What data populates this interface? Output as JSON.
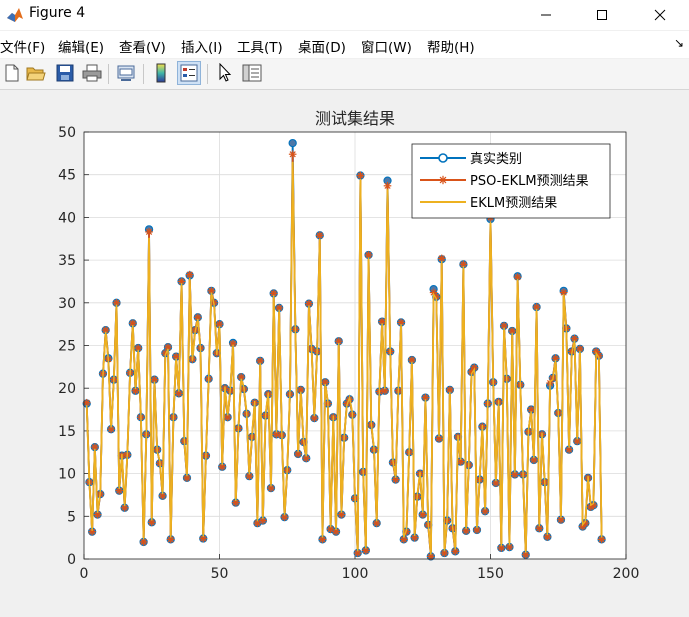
{
  "window": {
    "title": "Figure 4"
  },
  "menu": [
    "文件(F)",
    "编辑(E)",
    "查看(V)",
    "插入(I)",
    "工具(T)",
    "桌面(D)",
    "窗口(W)",
    "帮助(H)"
  ],
  "toolbar": {
    "icons": [
      "new-figure-icon",
      "open-file-icon",
      "save-icon",
      "print-icon",
      "link-plot-icon",
      "insert-colorbar-icon",
      "insert-legend-icon",
      "edit-plot-arrow-icon",
      "property-inspector-icon"
    ]
  },
  "colors": {
    "series1": "#0072bd",
    "series2": "#d95319",
    "series3": "#edb120",
    "marker_face": "#4d78a8"
  },
  "chart_data": {
    "type": "line",
    "title": "测试集结果",
    "xlim": [
      0,
      200
    ],
    "ylim": [
      0,
      50
    ],
    "xticks": [
      0,
      50,
      100,
      150,
      200
    ],
    "yticks": [
      0,
      5,
      10,
      15,
      20,
      25,
      30,
      35,
      40,
      45,
      50
    ],
    "grid": true,
    "legend_position": "top-right",
    "series": [
      {
        "name": "真实类别",
        "marker": "o"
      },
      {
        "name": "PSO-EKLM预测结果",
        "marker": "*"
      },
      {
        "name": "EKLM预测结果",
        "marker": "none"
      }
    ],
    "x": [
      1,
      2,
      3,
      4,
      5,
      6,
      7,
      8,
      9,
      10,
      11,
      12,
      13,
      14,
      15,
      16,
      17,
      18,
      19,
      20,
      21,
      22,
      23,
      24,
      25,
      26,
      27,
      28,
      29,
      30,
      31,
      32,
      33,
      34,
      35,
      36,
      37,
      38,
      39,
      40,
      41,
      42,
      43,
      44,
      45,
      46,
      47,
      48,
      49,
      50,
      51,
      52,
      53,
      54,
      55,
      56,
      57,
      58,
      59,
      60,
      61,
      62,
      63,
      64,
      65,
      66,
      67,
      68,
      69,
      70,
      71,
      72,
      73,
      74,
      75,
      76,
      77,
      78,
      79,
      80,
      81,
      82,
      83,
      84,
      85,
      86,
      87,
      88,
      89,
      90,
      91,
      92,
      93,
      94,
      95,
      96,
      97,
      98,
      99,
      100,
      101,
      102,
      103,
      104,
      105,
      106,
      107,
      108,
      109,
      110,
      111,
      112,
      113,
      114,
      115,
      116,
      117,
      118,
      119,
      120,
      121,
      122,
      123,
      124,
      125,
      126,
      127,
      128,
      129,
      130,
      131,
      132,
      133,
      134,
      135,
      136,
      137,
      138,
      139,
      140,
      141,
      142,
      143,
      144,
      145,
      146,
      147,
      148,
      149,
      150,
      151,
      152,
      153,
      154,
      155,
      156,
      157,
      158,
      159,
      160,
      161,
      162,
      163,
      164,
      165,
      166,
      167,
      168,
      169,
      170,
      171,
      172,
      173,
      174,
      175,
      176,
      177,
      178,
      179,
      180,
      181,
      182,
      183,
      184,
      185,
      186,
      187,
      188,
      189,
      190,
      191,
      192,
      193,
      194,
      195,
      196,
      197,
      198,
      199,
      200
    ],
    "true_values": [
      18.2,
      9,
      3.2,
      13.1,
      5.2,
      7.6,
      21.7,
      26.8,
      23.5,
      15.2,
      21,
      30,
      8,
      12.1,
      6,
      12.2,
      21.8,
      27.6,
      19.7,
      24.7,
      16.6,
      2,
      14.6,
      38.6,
      4.3,
      21,
      12.8,
      11.2,
      7.4,
      24.1,
      24.8,
      2.3,
      16.6,
      23.7,
      19.4,
      32.5,
      13.8,
      9.5,
      33.2,
      23.4,
      26.8,
      28.3,
      24.7,
      2.4,
      12.1,
      21.1,
      31.4,
      30,
      24.1,
      27.5,
      10.8,
      20,
      16.6,
      19.7,
      25.3,
      6.6,
      15.3,
      21.3,
      19.9,
      17,
      9.7,
      14.3,
      18.3,
      4.2,
      23.2,
      4.5,
      16.8,
      19.3,
      8.3,
      31.1,
      14.6,
      29.4,
      14.5,
      4.9,
      10.4,
      19.3,
      48.7,
      26.9,
      12.3,
      19.8,
      13.7,
      11.8,
      29.9,
      24.6,
      16.5,
      24.3,
      37.9,
      2.3,
      20.7,
      18.2,
      3.5,
      16.6,
      3.2,
      25.5,
      5.2,
      14.2,
      18.2,
      18.7,
      16.9,
      7.1,
      0.7,
      44.9,
      10.2,
      1,
      35.6,
      15.7,
      12.8,
      4.2,
      19.6,
      27.8,
      19.7,
      44.3,
      24.3,
      11.3,
      9.3,
      19.7,
      27.7,
      2.3,
      3.2,
      12.5,
      23.3,
      2.5,
      7.3,
      10,
      5.2,
      18.9,
      4,
      0.3,
      31.6,
      30.7,
      14.1,
      35.1,
      0.7,
      4.5,
      19.8,
      3.6,
      0.9,
      14.3,
      11.4,
      34.5,
      3.3,
      11,
      21.9,
      22.4,
      3.4,
      9.3,
      15.5,
      5.6,
      18.2,
      39.8,
      20.7,
      8.9,
      18.4,
      1.3,
      27.3,
      21.1,
      1.4,
      26.7,
      9.9,
      33.1,
      20.4,
      9.9,
      0.5,
      14.9,
      17.5,
      11.6,
      29.5,
      3.6,
      14.6,
      9,
      2.6,
      20.3,
      21.2,
      23.5,
      17.1,
      4.6,
      31.4,
      27,
      12.8,
      24.3,
      25.8,
      13.8,
      24.6,
      3.8,
      4.2,
      9.5,
      6.1,
      6.3,
      24.3,
      23.8,
      2.3
    ],
    "pso_ekl_values": [
      18.3,
      9,
      3.2,
      13.1,
      5.2,
      7.6,
      21.7,
      26.8,
      23.4,
      15.2,
      21,
      30,
      8,
      12.1,
      6,
      12.2,
      21.8,
      27.6,
      19.7,
      24.7,
      16.6,
      2,
      14.6,
      38.3,
      4.3,
      21,
      12.8,
      11.2,
      7.4,
      24.1,
      24.8,
      2.3,
      16.6,
      23.7,
      19.4,
      32.5,
      13.8,
      9.5,
      33.3,
      23.4,
      26.8,
      28.3,
      24.7,
      2.4,
      12.1,
      21.1,
      31.4,
      30,
      24.1,
      27.5,
      10.8,
      20,
      16.6,
      19.7,
      25.2,
      6.6,
      15.3,
      21.3,
      19.9,
      17,
      9.7,
      14.3,
      18.3,
      4.2,
      23.2,
      4.5,
      16.8,
      19.3,
      8.3,
      31.1,
      14.6,
      29.4,
      14.5,
      4.9,
      10.4,
      19.3,
      47.4,
      26.9,
      12.3,
      19.8,
      13.7,
      11.8,
      29.9,
      24.6,
      16.5,
      24.3,
      37.9,
      2.3,
      20.7,
      18.2,
      3.5,
      16.6,
      3.2,
      25.5,
      5.2,
      14.2,
      18.2,
      18.7,
      16.9,
      7.1,
      0.7,
      44.9,
      10.2,
      1,
      35.6,
      15.7,
      12.8,
      4.2,
      19.6,
      27.8,
      19.7,
      43.7,
      24.3,
      11.3,
      9.3,
      19.7,
      27.7,
      2.3,
      3.2,
      12.5,
      23.3,
      2.5,
      7.3,
      10,
      5.2,
      18.9,
      4,
      0.3,
      31.2,
      30.7,
      14.1,
      35.2,
      0.7,
      4.5,
      19.8,
      3.6,
      0.9,
      14.3,
      11.4,
      34.5,
      3.3,
      11,
      21.9,
      22.4,
      3.4,
      9.3,
      15.5,
      5.6,
      18.2,
      40,
      20.7,
      8.9,
      18.4,
      1.3,
      27.3,
      21.1,
      1.4,
      26.7,
      9.9,
      33,
      20.4,
      9.9,
      0.5,
      14.9,
      17.5,
      11.6,
      29.5,
      3.6,
      14.6,
      9,
      2.6,
      20.6,
      21.2,
      23.5,
      17.1,
      4.6,
      31.2,
      27,
      12.8,
      24.3,
      25.8,
      13.8,
      24.6,
      3.8,
      4.2,
      9.5,
      6.1,
      6.3,
      24.3,
      23.8,
      2.3
    ],
    "ekl_values": [
      18,
      8.8,
      3.3,
      12.9,
      5.4,
      7.8,
      21.5,
      26.6,
      23.2,
      15.4,
      20.8,
      29.8,
      8.2,
      12.3,
      6.2,
      12.4,
      21.6,
      27.4,
      19.9,
      24.5,
      16.8,
      2.3,
      14.8,
      37.6,
      4.5,
      20.8,
      12.6,
      11.4,
      7.6,
      23.9,
      24.6,
      2.5,
      16.8,
      23.5,
      19.6,
      32.3,
      14,
      9.7,
      32.9,
      23.2,
      26.6,
      28.1,
      24.5,
      2.6,
      12.3,
      20.9,
      31.2,
      29.8,
      23.9,
      27.3,
      11,
      20.2,
      16.8,
      19.9,
      25.1,
      6.8,
      15.5,
      21.1,
      20.1,
      17.2,
      9.9,
      14.5,
      18.5,
      4.4,
      23,
      4.7,
      16.9,
      19.5,
      8.5,
      30.9,
      14.8,
      29.2,
      14.7,
      5.1,
      10.6,
      19.5,
      46.5,
      26.7,
      12.5,
      19.6,
      13.9,
      12,
      29.7,
      24.4,
      16.7,
      24.1,
      37.5,
      2.5,
      20.5,
      18.4,
      3.7,
      16.8,
      3.4,
      25.3,
      5.4,
      14.4,
      18,
      18.9,
      17.1,
      7.3,
      0.9,
      44.5,
      10.4,
      1.2,
      35.3,
      15.9,
      13,
      4.4,
      19.8,
      27.6,
      19.9,
      43.3,
      24.1,
      11.5,
      9.5,
      19.9,
      27.5,
      2.5,
      3.4,
      12.7,
      23.1,
      2.7,
      7.5,
      10.2,
      5.4,
      18.7,
      4.2,
      0.5,
      31,
      30.5,
      14.3,
      34.9,
      0.9,
      4.7,
      19.6,
      3.8,
      1.1,
      14.5,
      11.6,
      34.3,
      3.5,
      11.2,
      21.7,
      22.2,
      3.6,
      9.5,
      15.7,
      5.8,
      18.4,
      39.5,
      20.5,
      9.1,
      18.6,
      1.5,
      27.1,
      20.9,
      1.6,
      26.5,
      10.1,
      32.8,
      20.6,
      10.1,
      0.7,
      15.1,
      17.3,
      11.8,
      29.3,
      3.8,
      14.8,
      9.2,
      2.8,
      20.8,
      21,
      23.3,
      17.3,
      4.8,
      31,
      26.8,
      13,
      24.1,
      25.6,
      14,
      24.4,
      4,
      4.4,
      9.7,
      6.3,
      6.5,
      24.1,
      23.6,
      2.5
    ]
  }
}
